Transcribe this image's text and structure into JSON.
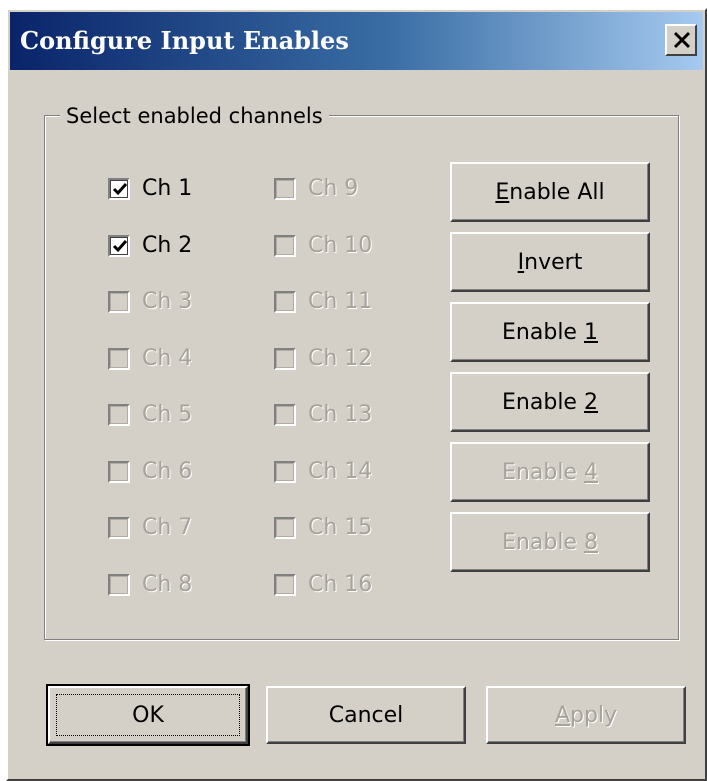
{
  "window": {
    "title": "Configure Input Enables",
    "close_label": "✕"
  },
  "group": {
    "label": "Select enabled channels"
  },
  "channels": [
    {
      "label": "Ch 1",
      "checked": true,
      "enabled": true
    },
    {
      "label": "Ch 2",
      "checked": true,
      "enabled": true
    },
    {
      "label": "Ch 3",
      "checked": false,
      "enabled": false
    },
    {
      "label": "Ch 4",
      "checked": false,
      "enabled": false
    },
    {
      "label": "Ch 5",
      "checked": false,
      "enabled": false
    },
    {
      "label": "Ch 6",
      "checked": false,
      "enabled": false
    },
    {
      "label": "Ch 7",
      "checked": false,
      "enabled": false
    },
    {
      "label": "Ch 8",
      "checked": false,
      "enabled": false
    },
    {
      "label": "Ch 9",
      "checked": false,
      "enabled": false
    },
    {
      "label": "Ch 10",
      "checked": false,
      "enabled": false
    },
    {
      "label": "Ch 11",
      "checked": false,
      "enabled": false
    },
    {
      "label": "Ch 12",
      "checked": false,
      "enabled": false
    },
    {
      "label": "Ch 13",
      "checked": false,
      "enabled": false
    },
    {
      "label": "Ch 14",
      "checked": false,
      "enabled": false
    },
    {
      "label": "Ch 15",
      "checked": false,
      "enabled": false
    },
    {
      "label": "Ch 16",
      "checked": false,
      "enabled": false
    }
  ],
  "side_buttons": [
    {
      "pre": "",
      "key": "E",
      "post": "nable All",
      "enabled": true
    },
    {
      "pre": "",
      "key": "I",
      "post": "nvert",
      "enabled": true
    },
    {
      "pre": "Enable ",
      "key": "1",
      "post": "",
      "enabled": true
    },
    {
      "pre": "Enable ",
      "key": "2",
      "post": "",
      "enabled": true
    },
    {
      "pre": "Enable ",
      "key": "4",
      "post": "",
      "enabled": false
    },
    {
      "pre": "Enable ",
      "key": "8",
      "post": "",
      "enabled": false
    }
  ],
  "footer": {
    "ok_label": "OK",
    "cancel_label": "Cancel",
    "apply_key": "A",
    "apply_rest": "pply",
    "apply_enabled": false
  },
  "colors": {
    "face": "#d4d0c8",
    "title_start": "#0a246a",
    "title_end": "#a6caf0",
    "disabled_text": "#a7a39b"
  }
}
